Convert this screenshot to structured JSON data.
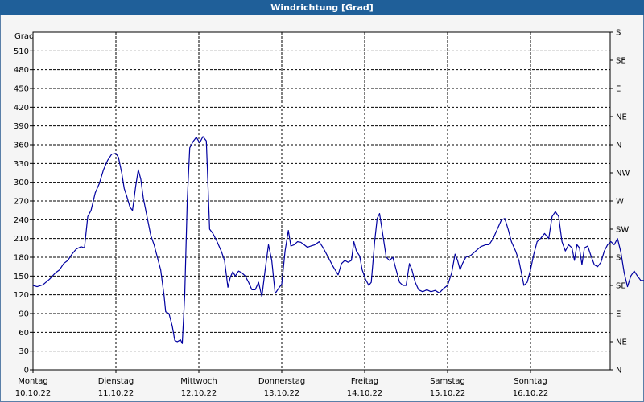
{
  "window": {
    "title": "Windrichtung [Grad]"
  },
  "chart_data": {
    "type": "line",
    "title": "Windrichtung [Grad]",
    "ylabel": "Grad",
    "ylim": [
      0,
      540
    ],
    "y_ticks": [
      0,
      30,
      60,
      90,
      120,
      150,
      180,
      210,
      240,
      270,
      300,
      330,
      360,
      390,
      420,
      450,
      480,
      510
    ],
    "right_axis_labels": [
      "N",
      "NE",
      "E",
      "SE",
      "S",
      "SW",
      "W",
      "NW",
      "N",
      "NE",
      "E",
      "SE",
      "S"
    ],
    "x_range": [
      0,
      7
    ],
    "x_ticks": [
      {
        "day": "Montag",
        "date": "10.10.22"
      },
      {
        "day": "Dienstag",
        "date": "11.10.22"
      },
      {
        "day": "Mittwoch",
        "date": "12.10.22"
      },
      {
        "day": "Donnerstag",
        "date": "13.10.22"
      },
      {
        "day": "Freitag",
        "date": "14.10.22"
      },
      {
        "day": "Samstag",
        "date": "15.10.22"
      },
      {
        "day": "Sonntag",
        "date": "16.10.22"
      }
    ],
    "grid": true,
    "series": [
      {
        "color": "#0000a0",
        "points": [
          [
            0,
            135
          ],
          [
            0.05,
            133
          ],
          [
            0.12,
            136
          ],
          [
            0.2,
            145
          ],
          [
            0.27,
            155
          ],
          [
            0.32,
            160
          ],
          [
            0.37,
            170
          ],
          [
            0.42,
            175
          ],
          [
            0.47,
            185
          ],
          [
            0.52,
            193
          ],
          [
            0.58,
            197
          ],
          [
            0.62,
            195
          ],
          [
            0.66,
            245
          ],
          [
            0.7,
            255
          ],
          [
            0.75,
            283
          ],
          [
            0.8,
            298
          ],
          [
            0.85,
            320
          ],
          [
            0.9,
            335
          ],
          [
            0.95,
            345
          ],
          [
            1.0,
            346
          ],
          [
            1.03,
            340
          ],
          [
            1.07,
            315
          ],
          [
            1.1,
            290
          ],
          [
            1.13,
            278
          ],
          [
            1.17,
            260
          ],
          [
            1.2,
            255
          ],
          [
            1.24,
            295
          ],
          [
            1.27,
            320
          ],
          [
            1.3,
            305
          ],
          [
            1.33,
            275
          ],
          [
            1.38,
            242
          ],
          [
            1.42,
            215
          ],
          [
            1.46,
            200
          ],
          [
            1.5,
            180
          ],
          [
            1.54,
            160
          ],
          [
            1.58,
            120
          ],
          [
            1.6,
            93
          ],
          [
            1.64,
            90
          ],
          [
            1.68,
            70
          ],
          [
            1.71,
            47
          ],
          [
            1.74,
            45
          ],
          [
            1.78,
            48
          ],
          [
            1.8,
            42
          ],
          [
            1.83,
            120
          ],
          [
            1.86,
            270
          ],
          [
            1.89,
            355
          ],
          [
            1.93,
            365
          ],
          [
            1.97,
            372
          ],
          [
            2.01,
            363
          ],
          [
            2.05,
            373
          ],
          [
            2.09,
            366
          ],
          [
            2.13,
            225
          ],
          [
            2.17,
            218
          ],
          [
            2.22,
            205
          ],
          [
            2.27,
            190
          ],
          [
            2.31,
            175
          ],
          [
            2.35,
            132
          ],
          [
            2.38,
            148
          ],
          [
            2.41,
            157
          ],
          [
            2.44,
            150
          ],
          [
            2.48,
            158
          ],
          [
            2.52,
            155
          ],
          [
            2.56,
            150
          ],
          [
            2.6,
            140
          ],
          [
            2.64,
            128
          ],
          [
            2.68,
            128
          ],
          [
            2.72,
            140
          ],
          [
            2.76,
            117
          ],
          [
            2.8,
            160
          ],
          [
            2.84,
            200
          ],
          [
            2.88,
            175
          ],
          [
            2.92,
            122
          ],
          [
            2.96,
            130
          ],
          [
            3.0,
            137
          ],
          [
            3.04,
            190
          ],
          [
            3.08,
            223
          ],
          [
            3.11,
            198
          ],
          [
            3.15,
            200
          ],
          [
            3.19,
            205
          ],
          [
            3.23,
            204
          ],
          [
            3.27,
            200
          ],
          [
            3.31,
            196
          ],
          [
            3.35,
            198
          ],
          [
            3.4,
            200
          ],
          [
            3.45,
            205
          ],
          [
            3.5,
            195
          ],
          [
            3.56,
            180
          ],
          [
            3.62,
            165
          ],
          [
            3.68,
            152
          ],
          [
            3.72,
            170
          ],
          [
            3.76,
            175
          ],
          [
            3.8,
            172
          ],
          [
            3.84,
            175
          ],
          [
            3.87,
            205
          ],
          [
            3.9,
            190
          ],
          [
            3.94,
            182
          ],
          [
            3.97,
            160
          ],
          [
            4.01,
            145
          ],
          [
            4.05,
            135
          ],
          [
            4.08,
            140
          ],
          [
            4.12,
            205
          ],
          [
            4.15,
            242
          ],
          [
            4.18,
            250
          ],
          [
            4.22,
            215
          ],
          [
            4.26,
            180
          ],
          [
            4.3,
            175
          ],
          [
            4.34,
            180
          ],
          [
            4.38,
            160
          ],
          [
            4.42,
            140
          ],
          [
            4.46,
            135
          ],
          [
            4.5,
            135
          ],
          [
            4.54,
            170
          ],
          [
            4.57,
            160
          ],
          [
            4.61,
            140
          ],
          [
            4.65,
            128
          ],
          [
            4.7,
            125
          ],
          [
            4.75,
            128
          ],
          [
            4.8,
            125
          ],
          [
            4.85,
            127
          ],
          [
            4.9,
            123
          ],
          [
            4.95,
            130
          ],
          [
            5.0,
            135
          ],
          [
            5.05,
            155
          ],
          [
            5.09,
            185
          ],
          [
            5.12,
            175
          ],
          [
            5.15,
            160
          ],
          [
            5.18,
            170
          ],
          [
            5.22,
            180
          ],
          [
            5.28,
            183
          ],
          [
            5.34,
            190
          ],
          [
            5.4,
            197
          ],
          [
            5.46,
            200
          ],
          [
            5.5,
            200
          ],
          [
            5.55,
            210
          ],
          [
            5.6,
            225
          ],
          [
            5.65,
            240
          ],
          [
            5.69,
            242
          ],
          [
            5.73,
            225
          ],
          [
            5.77,
            205
          ],
          [
            5.82,
            190
          ],
          [
            5.86,
            175
          ],
          [
            5.89,
            155
          ],
          [
            5.92,
            135
          ],
          [
            5.96,
            140
          ],
          [
            6.0,
            160
          ],
          [
            6.04,
            185
          ],
          [
            6.08,
            205
          ],
          [
            6.12,
            210
          ],
          [
            6.17,
            218
          ],
          [
            6.22,
            210
          ],
          [
            6.26,
            245
          ],
          [
            6.3,
            253
          ],
          [
            6.34,
            245
          ],
          [
            6.38,
            205
          ],
          [
            6.42,
            190
          ],
          [
            6.46,
            200
          ],
          [
            6.5,
            195
          ],
          [
            6.53,
            175
          ],
          [
            6.56,
            200
          ],
          [
            6.59,
            195
          ],
          [
            6.62,
            168
          ],
          [
            6.65,
            195
          ],
          [
            6.69,
            198
          ],
          [
            6.73,
            182
          ],
          [
            6.77,
            168
          ],
          [
            6.81,
            165
          ],
          [
            6.85,
            172
          ],
          [
            6.89,
            190
          ],
          [
            6.93,
            200
          ],
          [
            6.97,
            205
          ],
          [
            7.01,
            200
          ],
          [
            7.05,
            210
          ],
          [
            7.09,
            188
          ],
          [
            7.13,
            155
          ],
          [
            7.17,
            133
          ],
          [
            7.21,
            150
          ],
          [
            7.25,
            158
          ],
          [
            7.29,
            150
          ],
          [
            7.33,
            143
          ],
          [
            7.38,
            143
          ],
          [
            7.42,
            140
          ],
          [
            7.46,
            143
          ],
          [
            7.5,
            135
          ],
          [
            7.55,
            135
          ],
          [
            7.6,
            130
          ]
        ]
      }
    ]
  }
}
